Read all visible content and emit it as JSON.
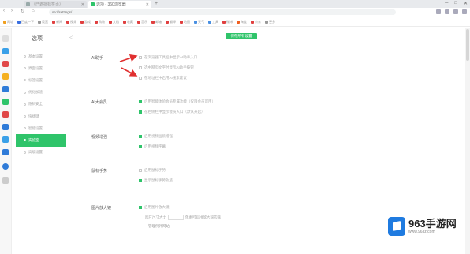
{
  "browser": {
    "tabs": [
      {
        "label": "（已遮挡标签页）",
        "active": false
      },
      {
        "label": "选项 - 360浏览器",
        "active": true
      }
    ],
    "new_tab_symbol": "+",
    "window_controls": [
      "─",
      "□",
      "✕"
    ],
    "nav": {
      "back": "‹",
      "forward": "›",
      "reload": "↻",
      "home": "⌂"
    },
    "url": "se://settings/",
    "bookmarks": [
      {
        "label": "网址",
        "color": "#f0a020"
      },
      {
        "label": "百度一下",
        "color": "#3a6fe0"
      },
      {
        "label": "设置",
        "color": "#999999"
      },
      {
        "label": "新闻",
        "color": "#e04040"
      },
      {
        "label": "视频",
        "color": "#e04040"
      },
      {
        "label": "游戏",
        "color": "#e04040"
      },
      {
        "label": "购物",
        "color": "#e04040"
      },
      {
        "label": "文档",
        "color": "#e04040"
      },
      {
        "label": "收藏",
        "color": "#e04040"
      },
      {
        "label": "音乐",
        "color": "#e04040"
      },
      {
        "label": "邮箱",
        "color": "#e04040"
      },
      {
        "label": "翻译",
        "color": "#e04040"
      },
      {
        "label": "地图",
        "color": "#e04040"
      },
      {
        "label": "天气",
        "color": "#4a90e2"
      },
      {
        "label": "工具",
        "color": "#4a90e2"
      },
      {
        "label": "微博",
        "color": "#e04040"
      },
      {
        "label": "淘宝",
        "color": "#f06020"
      },
      {
        "label": "京东",
        "color": "#e04040"
      },
      {
        "label": "更多",
        "color": "#999999"
      }
    ]
  },
  "settings": {
    "title": "选项",
    "save_button": "保存所有设置",
    "menu": [
      {
        "label": "基本设置",
        "active": false
      },
      {
        "label": "界面设置",
        "active": false
      },
      {
        "label": "标签设置",
        "active": false
      },
      {
        "label": "优化加速",
        "active": false
      },
      {
        "label": "隐私安全",
        "active": false
      },
      {
        "label": "快捷键",
        "active": false
      },
      {
        "label": "智能设置",
        "active": false
      },
      {
        "label": "实验室",
        "active": true
      },
      {
        "label": "高级设置",
        "active": false
      }
    ],
    "sections": [
      {
        "label": "AI助手",
        "options": [
          {
            "text": "在浏览器工具栏中显示AI助手入口",
            "checked": false
          },
          {
            "text": "选中网页文字时显示AI助手按钮",
            "checked": false
          },
          {
            "text": "在地址栏中启用AI搜索建议",
            "checked": false
          }
        ]
      },
      {
        "label": "AI大会员",
        "options": [
          {
            "text": "启用智能体验会员专属功能（仅限会员可用）",
            "checked": true
          },
          {
            "text": "在右侧栏中显示会员入口（默认开启）",
            "checked": true
          }
        ]
      },
      {
        "label": "视频增强",
        "options": [
          {
            "text": "启用视频画质增强",
            "checked": true
          },
          {
            "text": "启用视频字幕",
            "checked": true
          }
        ]
      },
      {
        "label": "鼠标手势",
        "options": [
          {
            "text": "启用鼠标手势",
            "checked": false
          },
          {
            "text": "显示鼠标手势轨迹",
            "checked": true
          }
        ]
      },
      {
        "label": "图片放大镜",
        "options": [
          {
            "text": "启用图片放大镜",
            "checked": true
          }
        ],
        "sub_text_prefix": "图片尺寸大于",
        "sub_text_suffix": "像素时启用放大镜功能",
        "sub_link": "管理例外网站"
      }
    ]
  },
  "watermark": {
    "main": "963手游网",
    "sub": "www.963z.com"
  }
}
